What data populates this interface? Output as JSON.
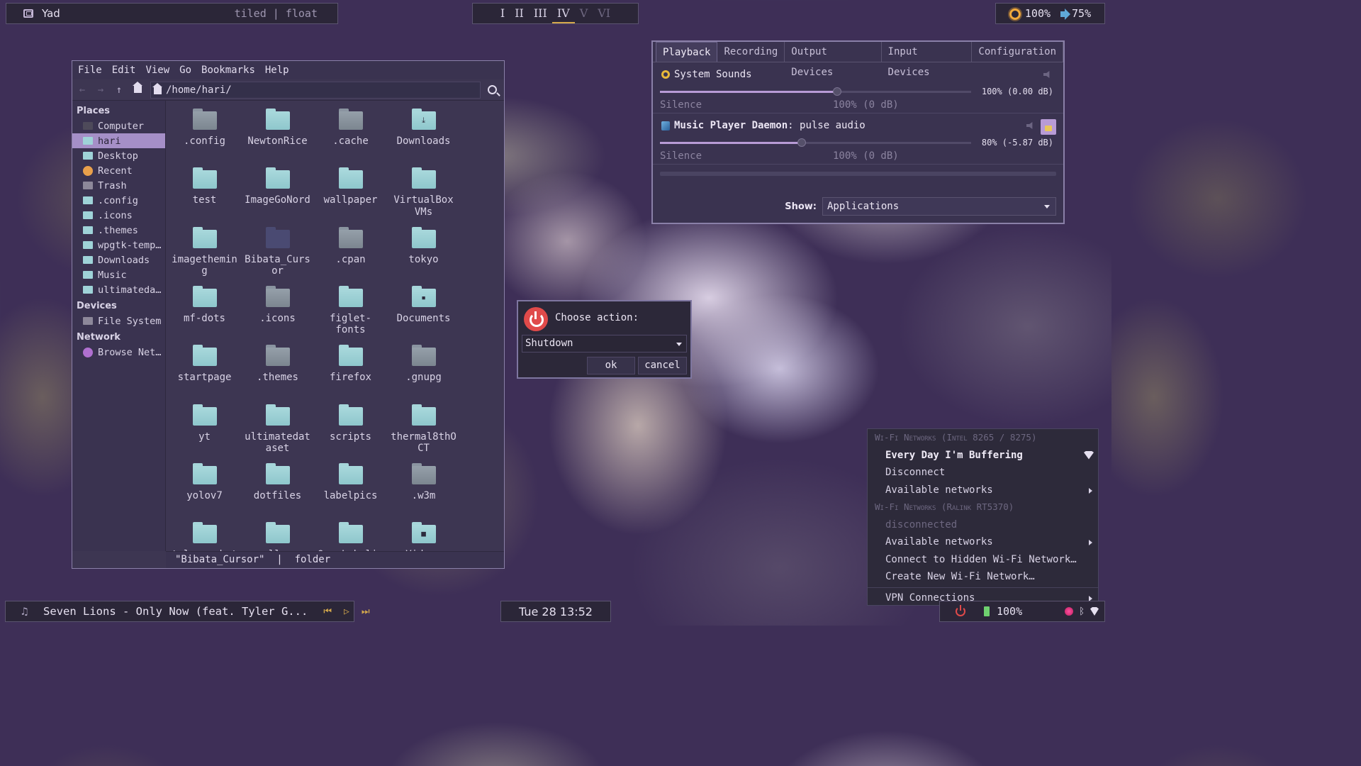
{
  "topbar": {
    "window_title": "Yad",
    "layout_modes": "tiled | float",
    "workspaces": [
      {
        "label": "I",
        "state": "normal"
      },
      {
        "label": "II",
        "state": "normal"
      },
      {
        "label": "III",
        "state": "normal"
      },
      {
        "label": "IV",
        "state": "active"
      },
      {
        "label": "V",
        "state": "dim"
      },
      {
        "label": "VI",
        "state": "dim"
      }
    ],
    "brightness": "100%",
    "volume": "75%"
  },
  "file_manager": {
    "menu": [
      "File",
      "Edit",
      "View",
      "Go",
      "Bookmarks",
      "Help"
    ],
    "path": "/home/hari/",
    "sidebar": {
      "places_header": "Places",
      "places": [
        "Computer",
        "hari",
        "Desktop",
        "Recent",
        "Trash",
        ".config",
        ".icons",
        ".themes",
        "wpgtk-temp…",
        "Downloads",
        "Music",
        "ultimateda…"
      ],
      "selected_place": "hari",
      "devices_header": "Devices",
      "devices": [
        "File System"
      ],
      "network_header": "Network",
      "network": [
        "Browse Net…"
      ]
    },
    "items": [
      {
        "name": ".config",
        "color": "gray"
      },
      {
        "name": "NewtonRice",
        "color": "teal"
      },
      {
        "name": ".cache",
        "color": "gray"
      },
      {
        "name": "Downloads",
        "color": "teal",
        "symbol": "download"
      },
      {
        "name": "test",
        "color": "teal"
      },
      {
        "name": "ImageGoNord",
        "color": "teal"
      },
      {
        "name": "wallpaper",
        "color": "teal"
      },
      {
        "name": "VirtualBox VMs",
        "color": "teal"
      },
      {
        "name": "imagethemin g",
        "color": "teal"
      },
      {
        "name": "Bibata_Curs or",
        "color": "navy"
      },
      {
        "name": ".cpan",
        "color": "gray"
      },
      {
        "name": "tokyo",
        "color": "teal"
      },
      {
        "name": "mf-dots",
        "color": "teal"
      },
      {
        "name": ".icons",
        "color": "gray"
      },
      {
        "name": "figlet- fonts",
        "color": "teal"
      },
      {
        "name": "Documents",
        "color": "teal",
        "symbol": "document"
      },
      {
        "name": "startpage",
        "color": "teal"
      },
      {
        "name": ".themes",
        "color": "gray"
      },
      {
        "name": "firefox",
        "color": "teal"
      },
      {
        "name": ".gnupg",
        "color": "gray"
      },
      {
        "name": "yt",
        "color": "teal"
      },
      {
        "name": "ultimatedat aset",
        "color": "teal"
      },
      {
        "name": "scripts",
        "color": "teal"
      },
      {
        "name": "thermal8thO CT",
        "color": "teal"
      },
      {
        "name": "yolov7",
        "color": "teal"
      },
      {
        "name": "dotfiles",
        "color": "teal"
      },
      {
        "name": "labelpics",
        "color": "teal"
      },
      {
        "name": ".w3m",
        "color": "gray"
      },
      {
        "name": "telegrambot",
        "color": "teal"
      },
      {
        "name": "college",
        "color": "teal"
      },
      {
        "name": "OpenLabelin g",
        "color": "teal"
      },
      {
        "name": "Videos",
        "color": "teal",
        "symbol": "video"
      }
    ],
    "status": "\"Bibata_Cursor\"  |  folder"
  },
  "pavucontrol": {
    "tabs": [
      "Playback",
      "Recording",
      "Output Devices",
      "Input Devices",
      "Configuration"
    ],
    "active_tab": "Playback",
    "streams": [
      {
        "name_bold": "",
        "name": "System Sounds",
        "level_fraction": 1.0,
        "value_text": "100% (0.00 dB)",
        "left_label": "Silence",
        "mid_label": "100% (0 dB)"
      },
      {
        "name_bold": "Music Player Daemon",
        "name": ": pulse audio",
        "level_fraction": 0.8,
        "value_text": "80% (-5.87 dB)",
        "left_label": "Silence",
        "mid_label": "100% (0 dB)"
      }
    ],
    "show_label": "Show:",
    "show_value": "Applications"
  },
  "dialog": {
    "title": "Choose action:",
    "selected": "Shutdown",
    "ok_label": "ok",
    "cancel_label": "cancel"
  },
  "network_menu": {
    "header1": "Wi-Fi Networks (Intel 8265 / 8275)",
    "connected_ssid": "Every Day I'm Buffering",
    "disconnect": "Disconnect",
    "available1": "Available networks",
    "header2": "Wi-Fi Networks (Ralink RT5370)",
    "disconnected": "disconnected",
    "available2": "Available networks",
    "connect_hidden": "Connect to Hidden Wi-Fi Network…",
    "create_new": "Create New Wi-Fi Network…",
    "vpn": "VPN Connections"
  },
  "bottombar": {
    "now_playing": "Seven Lions - Only Now (feat. Tyler G...",
    "clock": "Tue 28 13:52",
    "battery": "100%"
  },
  "colors": {
    "accent": "#a58fc7",
    "workspace_active_underline": "#d4a84b",
    "folder_teal": "#a6d6da",
    "folder_gray": "#8a94a0",
    "power_red": "#e04a4a"
  }
}
